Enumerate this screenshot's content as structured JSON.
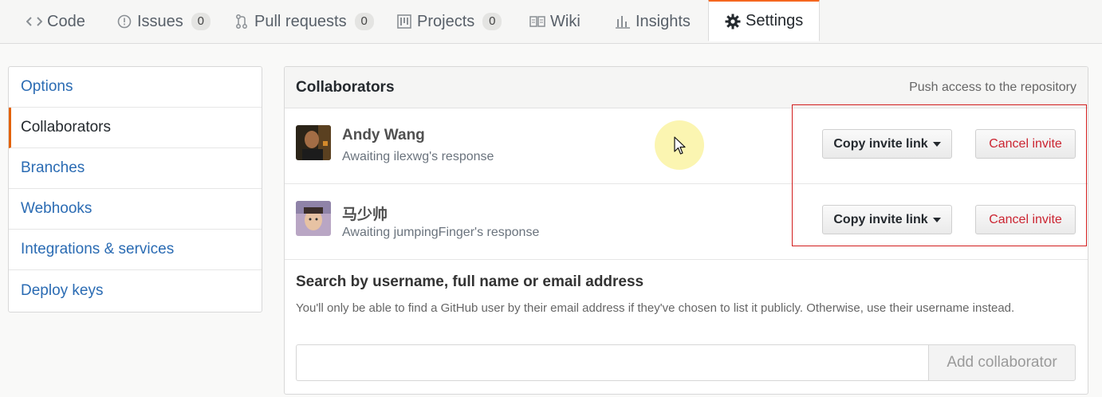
{
  "tabs": [
    {
      "label": "Code",
      "icon": "code-icon"
    },
    {
      "label": "Issues",
      "icon": "issue-icon",
      "count": "0"
    },
    {
      "label": "Pull requests",
      "icon": "pull-request-icon",
      "count": "0"
    },
    {
      "label": "Projects",
      "icon": "project-icon",
      "count": "0"
    },
    {
      "label": "Wiki",
      "icon": "book-icon"
    },
    {
      "label": "Insights",
      "icon": "graph-icon"
    },
    {
      "label": "Settings",
      "icon": "gear-icon",
      "selected": true
    }
  ],
  "menu": {
    "items": [
      {
        "label": "Options"
      },
      {
        "label": "Collaborators",
        "selected": true
      },
      {
        "label": "Branches"
      },
      {
        "label": "Webhooks"
      },
      {
        "label": "Integrations & services"
      },
      {
        "label": "Deploy keys"
      }
    ]
  },
  "collaborators": {
    "title": "Collaborators",
    "meta": "Push access to the repository",
    "rows": [
      {
        "name": "Andy Wang",
        "status": "Awaiting ilexwg's response",
        "copy_label": "Copy invite link",
        "cancel_label": "Cancel invite"
      },
      {
        "name": "马少帅",
        "status": "Awaiting jumpingFinger's response",
        "copy_label": "Copy invite link",
        "cancel_label": "Cancel invite"
      }
    ]
  },
  "search": {
    "title": "Search by username, full name or email address",
    "help": "You'll only be able to find a GitHub user by their email address if they've chosen to list it publicly. Otherwise, use their username instead.",
    "placeholder": "",
    "add_label": "Add collaborator"
  },
  "colors": {
    "accent_tab": "#f5671f",
    "link": "#2a6bb3",
    "danger": "#cb2431",
    "highlight": "#d21d1d"
  }
}
